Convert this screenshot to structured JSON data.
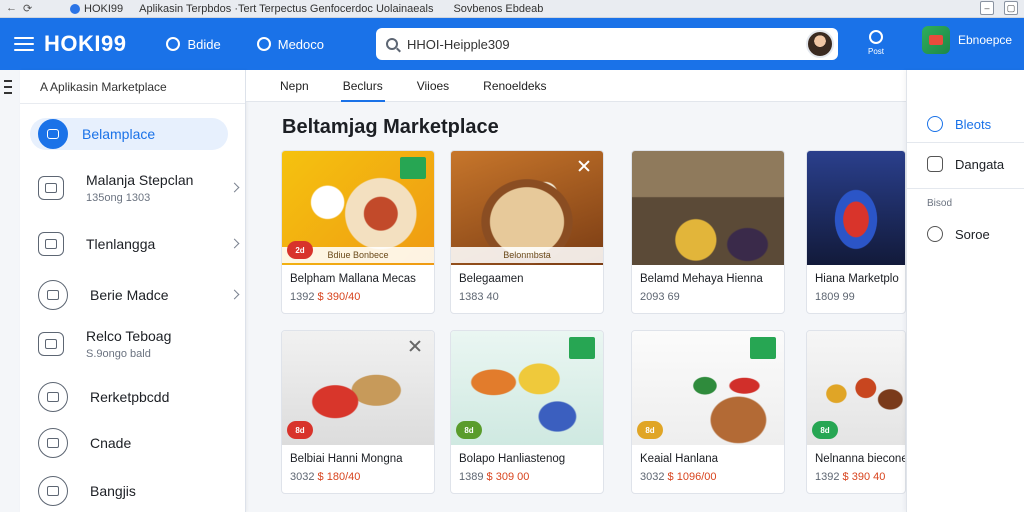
{
  "browser": {
    "tab_title": "HOKI99",
    "tab_caption": "Aplikasin Terpbdos ·Tert Terpectus Genfocerdoc Uolainaeals",
    "tab_caption_2": "Sovbenos Ebdeab"
  },
  "appbar": {
    "brand": "HOKI99",
    "link1": "Bdide",
    "link2": "Medoco",
    "search_value": "HHOI-Heipple309",
    "post_label": "Post",
    "store_label": "Ebnoepce"
  },
  "sidebar": {
    "header": "A Aplikasin Marketplace",
    "items": [
      {
        "label": "Belamplace",
        "sub": ""
      },
      {
        "label": "Malanja Stepclan",
        "sub": "135ong 1303"
      },
      {
        "label": "Tlenlangga",
        "sub": ""
      },
      {
        "label": "Berie Madce",
        "sub": ""
      },
      {
        "label": "Relco Teboag",
        "sub": "S.9ongo bald"
      },
      {
        "label": "Rerketpbcdd",
        "sub": ""
      },
      {
        "label": "Cnade",
        "sub": ""
      },
      {
        "label": "Bangjis",
        "sub": ""
      }
    ]
  },
  "tabs": [
    "Nepn",
    "Beclurs",
    "Viioes",
    "Renoeldeks"
  ],
  "main": {
    "title": "Beltamjag Marketplace",
    "cards": [
      {
        "name": "Belpham Mallana Mecas",
        "price": "1392",
        "price_hl": "$ 390/40",
        "badge": "2d",
        "caption": "Bdiue Bonbece",
        "badge_color": "#d8332b"
      },
      {
        "name": "Belegaamen",
        "price": "1383 40",
        "price_hl": "",
        "badge": "",
        "caption": "Belonmbsta",
        "badge_color": ""
      },
      {
        "name": "Belamd Mehaya Hienna",
        "price": "2093 69",
        "price_hl": "",
        "badge": "",
        "caption": "",
        "badge_color": ""
      },
      {
        "name": "Hiana Marketplo",
        "price": "1809 99",
        "price_hl": "",
        "badge": "",
        "caption": "",
        "badge_color": ""
      },
      {
        "name": "Belbiai Hanni Mongna",
        "price": "3032",
        "price_hl": "$ 180/40",
        "badge": "8d",
        "caption": "",
        "badge_color": "#d8332b"
      },
      {
        "name": "Bolapo Hanliastenog",
        "price": "1389",
        "price_hl": "$ 309 00",
        "badge": "8d",
        "caption": "",
        "badge_color": "#5a9c2c"
      },
      {
        "name": "Keaial Hanlana",
        "price": "3032",
        "price_hl": "$ 1096/00",
        "badge": "8d",
        "caption": "",
        "badge_color": "#e0a526"
      },
      {
        "name": "Nelnanna bieconer",
        "price": "1392",
        "price_hl": "$ 390 40",
        "badge": "8d",
        "caption": "",
        "badge_color": "#27a653"
      }
    ]
  },
  "rpanel": {
    "item1": "Bleots",
    "item2": "Dangata",
    "section": "Bisod",
    "item3": "Soroe"
  },
  "colors": {
    "accent": "#1a72e8",
    "price_highlight": "#d8441e"
  }
}
